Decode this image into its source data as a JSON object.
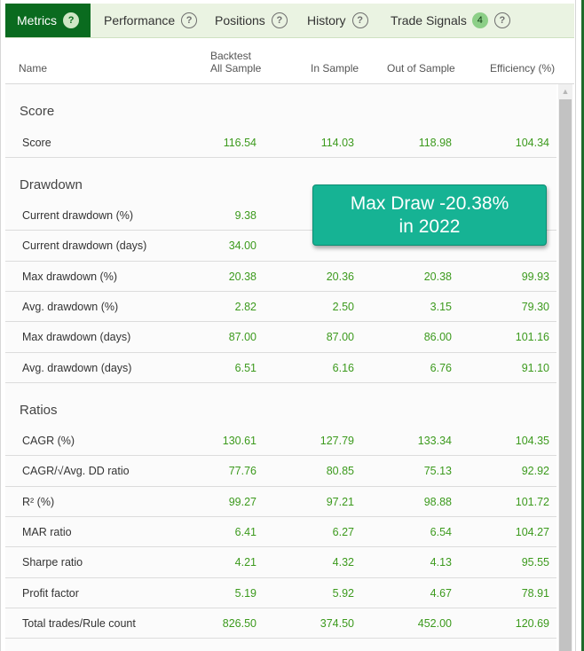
{
  "tabs": [
    {
      "label": "Metrics",
      "active": true
    },
    {
      "label": "Performance"
    },
    {
      "label": "Positions"
    },
    {
      "label": "History"
    },
    {
      "label": "Trade Signals",
      "badge": "4"
    }
  ],
  "help_glyph": "?",
  "columns": {
    "name": "Name",
    "backtest_line1": "Backtest",
    "backtest_line2": "All Sample",
    "in_sample": "In Sample",
    "out_of_sample": "Out of Sample",
    "efficiency": "Efficiency (%)"
  },
  "sections": [
    {
      "title": "Score",
      "rows": [
        {
          "name": "Score",
          "backtest": "116.54",
          "in": "114.03",
          "out": "118.98",
          "eff": "104.34"
        }
      ]
    },
    {
      "title": "Drawdown",
      "rows": [
        {
          "name": "Current drawdown (%)",
          "backtest": "9.38",
          "in": "",
          "out": "",
          "eff": ""
        },
        {
          "name": "Current drawdown (days)",
          "backtest": "34.00",
          "in": "",
          "out": "",
          "eff": ""
        },
        {
          "name": "Max drawdown (%)",
          "backtest": "20.38",
          "in": "20.36",
          "out": "20.38",
          "eff": "99.93"
        },
        {
          "name": "Avg. drawdown (%)",
          "backtest": "2.82",
          "in": "2.50",
          "out": "3.15",
          "eff": "79.30"
        },
        {
          "name": "Max drawdown (days)",
          "backtest": "87.00",
          "in": "87.00",
          "out": "86.00",
          "eff": "101.16"
        },
        {
          "name": "Avg. drawdown (days)",
          "backtest": "6.51",
          "in": "6.16",
          "out": "6.76",
          "eff": "91.10"
        }
      ]
    },
    {
      "title": "Ratios",
      "rows": [
        {
          "name": "CAGR (%)",
          "backtest": "130.61",
          "in": "127.79",
          "out": "133.34",
          "eff": "104.35"
        },
        {
          "name": "CAGR/√Avg. DD ratio",
          "backtest": "77.76",
          "in": "80.85",
          "out": "75.13",
          "eff": "92.92"
        },
        {
          "name": "R² (%)",
          "backtest": "99.27",
          "in": "97.21",
          "out": "98.88",
          "eff": "101.72"
        },
        {
          "name": "MAR ratio",
          "backtest": "6.41",
          "in": "6.27",
          "out": "6.54",
          "eff": "104.27"
        },
        {
          "name": "Sharpe ratio",
          "backtest": "4.21",
          "in": "4.32",
          "out": "4.13",
          "eff": "95.55"
        },
        {
          "name": "Profit factor",
          "backtest": "5.19",
          "in": "5.92",
          "out": "4.67",
          "eff": "78.91"
        },
        {
          "name": "Total trades/Rule count",
          "backtest": "826.50",
          "in": "374.50",
          "out": "452.00",
          "eff": "120.69"
        }
      ]
    }
  ],
  "tooltip": {
    "line1": "Max Draw -20.38%",
    "line2": "in 2022"
  },
  "colors": {
    "tab_active": "#0a6b1f",
    "tabbar_bg": "#eaf3e2",
    "value_green": "#3c9a1d",
    "tooltip_bg": "#16b394"
  },
  "icons": {
    "help": "question-circle-icon",
    "scroll_up": "scroll-up-arrow-icon"
  }
}
